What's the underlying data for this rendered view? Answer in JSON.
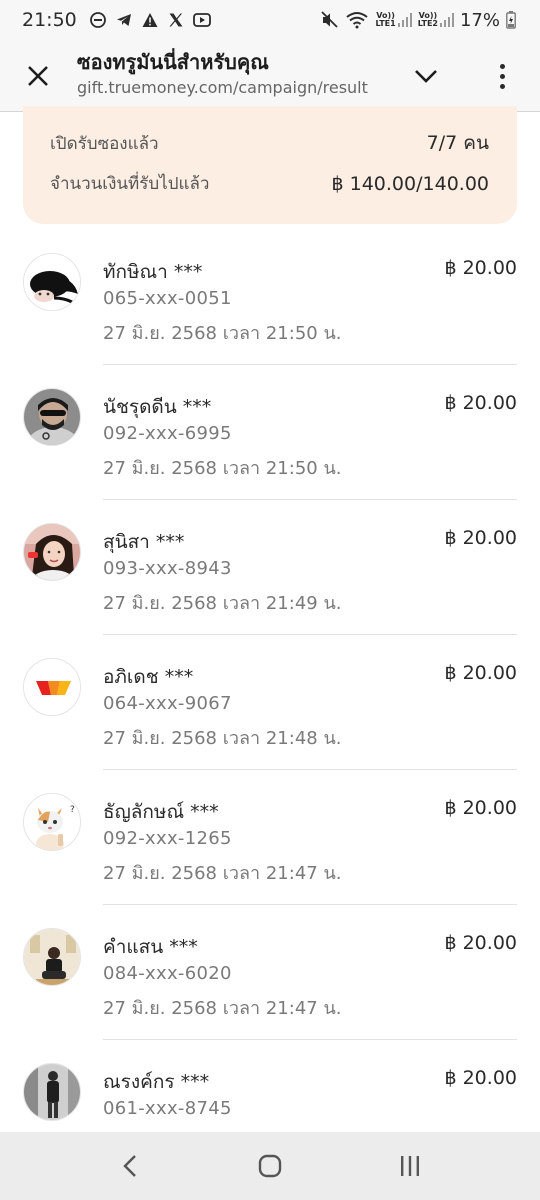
{
  "status_bar": {
    "time": "21:50",
    "battery": "17%",
    "sim1": "LTE1",
    "sim2": "LTE2",
    "volte": "Vo))"
  },
  "browser": {
    "title": "ซองทรูมันนี่สำหรับคุณ",
    "url": "gift.truemoney.com/campaign/result"
  },
  "summary": {
    "opened_label": "เปิดรับซองแล้ว",
    "opened_value": "7/7 คน",
    "amount_label": "จำนวนเงินที่รับไปแล้ว",
    "amount_value": "฿ 140.00/140.00"
  },
  "recipients": [
    {
      "name": "ทักษิณา ***",
      "phone": "065-xxx-0051",
      "time": "27 มิ.ย. 2568 เวลา 21:50 น.",
      "amount": "฿ 20.00",
      "avatar": "anime-character-avatar"
    },
    {
      "name": "นัชรุดดีน ***",
      "phone": "092-xxx-6995",
      "time": "27 มิ.ย. 2568 เวลา 21:50 น.",
      "amount": "฿ 20.00",
      "avatar": "man-sunglasses-avatar"
    },
    {
      "name": "สุนิสา ***",
      "phone": "093-xxx-8943",
      "time": "27 มิ.ย. 2568 เวลา 21:49 น.",
      "amount": "฿ 20.00",
      "avatar": "woman-photo-avatar"
    },
    {
      "name": "อภิเดช ***",
      "phone": "064-xxx-9067",
      "time": "27 มิ.ย. 2568 เวลา 21:48 น.",
      "amount": "฿ 20.00",
      "avatar": "truemoney-logo-avatar"
    },
    {
      "name": "ธัญลักษณ์ ***",
      "phone": "092-xxx-1265",
      "time": "27 มิ.ย. 2568 เวลา 21:47 น.",
      "amount": "฿ 20.00",
      "avatar": "cat-avatar"
    },
    {
      "name": "คำแสน ***",
      "phone": "084-xxx-6020",
      "time": "27 มิ.ย. 2568 เวลา 21:47 น.",
      "amount": "฿ 20.00",
      "avatar": "person-sitting-avatar"
    },
    {
      "name": "ณรงค์กร ***",
      "phone": "061-xxx-8745",
      "time": "",
      "amount": "฿ 20.00",
      "avatar": "person-standing-avatar"
    }
  ],
  "colors": {
    "summary_bg": "#fdeee3",
    "text": "#2a2a2a",
    "muted": "#7a7a7a"
  }
}
